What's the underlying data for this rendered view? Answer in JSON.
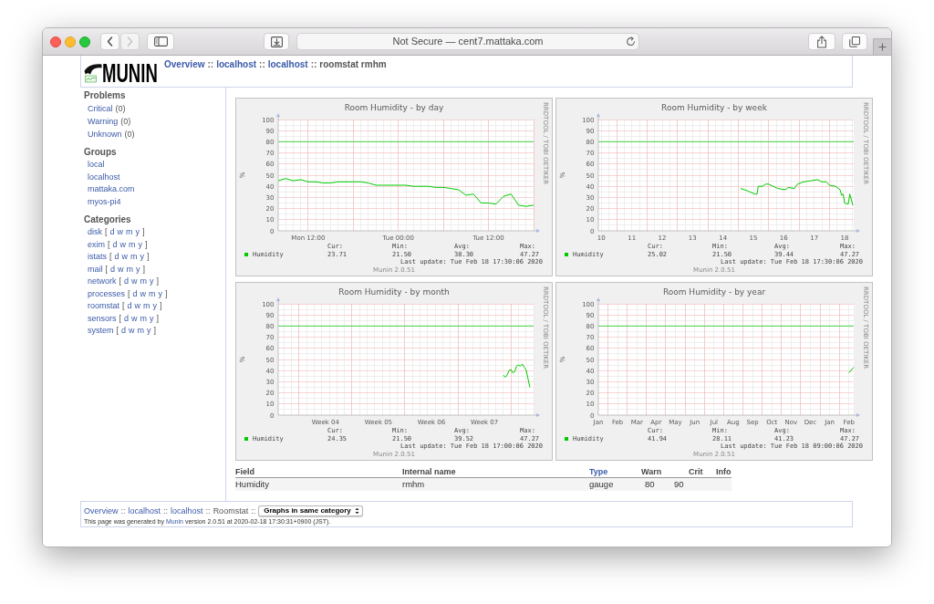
{
  "browser": {
    "address": "Not Secure — cent7.mattaka.com",
    "back": {
      "disabled": false
    },
    "forward": {
      "disabled": true
    }
  },
  "header": {
    "logo": "MUNIN",
    "breadcrumb": [
      {
        "kind": "link",
        "text": "Overview"
      },
      {
        "kind": "separator",
        "text": "::"
      },
      {
        "kind": "link",
        "text": "localhost"
      },
      {
        "kind": "separator",
        "text": "::"
      },
      {
        "kind": "link",
        "text": "localhost"
      },
      {
        "kind": "separator",
        "text": "::"
      },
      {
        "kind": "text",
        "text": "roomstat rmhm"
      }
    ]
  },
  "sidebar": {
    "problems": {
      "heading": "Problems",
      "items": [
        {
          "label": "Critical",
          "count": "(0)"
        },
        {
          "label": "Warning",
          "count": "(0)"
        },
        {
          "label": "Unknown",
          "count": "(0)"
        }
      ]
    },
    "groups": {
      "heading": "Groups",
      "items": [
        "local",
        "localhost",
        "mattaka.com",
        "myos-pi4"
      ]
    },
    "categories": {
      "heading": "Categories",
      "items": [
        {
          "name": "disk",
          "open": "[",
          "periods": [
            "d",
            "w",
            "m",
            "y"
          ],
          "close": "]"
        },
        {
          "name": "exim",
          "open": "[",
          "periods": [
            "d",
            "w",
            "m",
            "y"
          ],
          "close": "]"
        },
        {
          "name": "istats",
          "open": "[",
          "periods": [
            "d",
            "w",
            "m",
            "y"
          ],
          "close": "]"
        },
        {
          "name": "mail",
          "open": "[",
          "periods": [
            "d",
            "w",
            "m",
            "y"
          ],
          "close": "]"
        },
        {
          "name": "network",
          "open": "[",
          "periods": [
            "d",
            "w",
            "m",
            "y"
          ],
          "close": "]"
        },
        {
          "name": "processes",
          "open": "[",
          "periods": [
            "d",
            "w",
            "m",
            "y"
          ],
          "close": "]"
        },
        {
          "name": "roomstat",
          "open": "[",
          "periods": [
            "d",
            "w",
            "m",
            "y"
          ],
          "close": "]"
        },
        {
          "name": "sensors",
          "open": "[",
          "periods": [
            "d",
            "w",
            "m",
            "y"
          ],
          "close": "]"
        },
        {
          "name": "system",
          "open": "[",
          "periods": [
            "d",
            "w",
            "m",
            "y"
          ],
          "close": "]"
        }
      ]
    }
  },
  "graphs": [
    {
      "side_text": "RRDTOOL / TOBI OETIKER",
      "stat_headers": [
        "Cur:",
        "Min:",
        "Avg:",
        "Max:"
      ],
      "stat_values": [
        "23.71",
        "21.50",
        "38.30",
        "47.27"
      ],
      "last_update": "Last update: Tue Feb 18 17:30:06 2020",
      "credit": "Munin 2.0.51",
      "chart_data": {
        "type": "line",
        "title": "Room Humidity - by day",
        "ylabel": "%",
        "grid": true,
        "categories": [
          null,
          null,
          null,
          null,
          "Mon 12:00",
          null,
          null,
          null,
          null,
          null,
          null,
          null,
          null,
          null,
          null,
          null,
          "Tue 00:00",
          null,
          null,
          null,
          null,
          null,
          null,
          null,
          null,
          null,
          null,
          null,
          "Tue 12:00",
          null,
          null,
          null,
          null,
          null,
          null
        ],
        "series": [
          {
            "name": "Humidity",
            "color": "#00cc00",
            "values": [
              45,
              47,
              45,
              46,
              44,
              44,
              43,
              43,
              44,
              44,
              44,
              44,
              43,
              41,
              41,
              41,
              41,
              41,
              40,
              40,
              40,
              39,
              39,
              38,
              37,
              32,
              33,
              25,
              25,
              24,
              31,
              33,
              23,
              22,
              23
            ]
          }
        ],
        "ylim": [
          0,
          100
        ],
        "yticks": [
          0,
          10,
          20,
          30,
          40,
          50,
          60,
          70,
          80,
          90,
          100
        ],
        "ref_lines": [
          {
            "axis": "y",
            "value": 80
          }
        ]
      }
    },
    {
      "side_text": "RRDTOOL / TOBI OETIKER",
      "stat_headers": [
        "Cur:",
        "Min:",
        "Avg:",
        "Max:"
      ],
      "stat_values": [
        "25.02",
        "21.50",
        "39.44",
        "47.27"
      ],
      "last_update": "Last update: Tue Feb 18 17:30:06 2020",
      "credit": "Munin 2.0.51",
      "chart_data": {
        "type": "line",
        "title": "Room Humidity - by week",
        "ylabel": "%",
        "grid": true,
        "x": [
          14.58,
          14.8,
          15.05,
          15.12,
          15.16,
          15.3,
          15.4,
          15.5,
          15.8,
          16.05,
          16.15,
          16.35,
          16.45,
          16.65,
          16.9,
          17.1,
          17.25,
          17.4,
          17.5,
          17.7,
          17.85,
          17.9,
          17.95,
          18.0,
          18.12,
          18.17,
          18.27
        ],
        "series": [
          {
            "name": "Humidity",
            "color": "#00cc00",
            "values": [
              38,
              36,
              33,
              33,
              40,
              40,
              42,
              42,
              38,
              37,
              39,
              38,
              42,
              44,
              45,
              46,
              44,
              44,
              41,
              40,
              37,
              32,
              33,
              25,
              24,
              33,
              23
            ]
          }
        ],
        "xlim": [
          9.9,
          18.3
        ],
        "ylim": [
          0,
          100
        ],
        "xticks": [
          10,
          11,
          12,
          13,
          14,
          15,
          16,
          17,
          18
        ],
        "yticks": [
          0,
          10,
          20,
          30,
          40,
          50,
          60,
          70,
          80,
          90,
          100
        ],
        "ref_lines": [
          {
            "axis": "y",
            "value": 80
          }
        ]
      }
    },
    {
      "side_text": "RRDTOOL / TOBI OETIKER",
      "stat_headers": [
        "Cur:",
        "Min:",
        "Avg:",
        "Max:"
      ],
      "stat_values": [
        "24.35",
        "21.50",
        "39.52",
        "47.27"
      ],
      "last_update": "Last update: Tue Feb 18 17:00:06 2020",
      "credit": "Munin 2.0.51",
      "chart_data": {
        "type": "line",
        "title": "Room Humidity - by month",
        "ylabel": "%",
        "grid": true,
        "categories": [
          null,
          null,
          null,
          null,
          null,
          null,
          null,
          null,
          null,
          null,
          null,
          null,
          null,
          null,
          null,
          null,
          null,
          null,
          null,
          null,
          null,
          null,
          null,
          null,
          null,
          "Week 04",
          null,
          null,
          null,
          null,
          null,
          null,
          null,
          null,
          null,
          null,
          null,
          null,
          null,
          null,
          null,
          null,
          null,
          null,
          null,
          null,
          null,
          null,
          null,
          null,
          null,
          null,
          null,
          "Week 05",
          null,
          null,
          null,
          null,
          null,
          null,
          null,
          null,
          null,
          null,
          null,
          null,
          null,
          null,
          null,
          null,
          null,
          null,
          null,
          null,
          null,
          null,
          null,
          null,
          null,
          null,
          null,
          "Week 06",
          null,
          null,
          null,
          null,
          null,
          null,
          null,
          null,
          null,
          null,
          null,
          null,
          null,
          null,
          null,
          null,
          null,
          null,
          null,
          null,
          null,
          null,
          null,
          null,
          null,
          null,
          null,
          "Week 07",
          null,
          null,
          null,
          null,
          null,
          null,
          null,
          null,
          null,
          null,
          null,
          null,
          null,
          null,
          null,
          null,
          null,
          null,
          null,
          null,
          null,
          null,
          null,
          null,
          null,
          null
        ],
        "series": [
          {
            "name": "Humidity",
            "color": "#00cc00",
            "values": [
              null,
              null,
              null,
              null,
              null,
              null,
              null,
              null,
              null,
              null,
              null,
              null,
              null,
              null,
              null,
              null,
              null,
              null,
              null,
              null,
              null,
              null,
              null,
              null,
              null,
              null,
              null,
              null,
              null,
              null,
              null,
              null,
              null,
              null,
              null,
              null,
              null,
              null,
              null,
              null,
              null,
              null,
              null,
              null,
              null,
              null,
              null,
              null,
              null,
              null,
              null,
              null,
              null,
              null,
              null,
              null,
              null,
              null,
              null,
              null,
              null,
              null,
              null,
              null,
              null,
              null,
              null,
              null,
              null,
              null,
              null,
              null,
              null,
              null,
              null,
              null,
              null,
              null,
              null,
              null,
              null,
              null,
              null,
              null,
              null,
              null,
              null,
              null,
              null,
              null,
              null,
              null,
              null,
              null,
              null,
              null,
              null,
              null,
              null,
              null,
              null,
              null,
              null,
              null,
              null,
              null,
              null,
              null,
              null,
              null,
              null,
              null,
              null,
              null,
              null,
              null,
              null,
              null,
              null,
              36,
              34,
              36,
              40,
              41,
              38,
              39,
              44,
              45,
              44,
              46,
              43,
              41,
              33,
              25,
              null,
              null
            ]
          }
        ],
        "ylim": [
          0,
          100
        ],
        "yticks": [
          0,
          10,
          20,
          30,
          40,
          50,
          60,
          70,
          80,
          90,
          100
        ],
        "ref_lines": [
          {
            "axis": "y",
            "value": 80
          }
        ]
      }
    },
    {
      "side_text": "RRDTOOL / TOBI OETIKER",
      "stat_headers": [
        "Cur:",
        "Min:",
        "Avg:",
        "Max:"
      ],
      "stat_values": [
        "41.94",
        "28.11",
        "41.23",
        "47.27"
      ],
      "last_update": "Last update: Tue Feb 18 09:00:06 2020",
      "credit": "Munin 2.0.51",
      "chart_data": {
        "type": "line",
        "title": "Room Humidity - by year",
        "ylabel": "%",
        "grid": true,
        "categories": [
          "Jan",
          null,
          null,
          null,
          "Feb",
          null,
          null,
          null,
          "Mar",
          null,
          null,
          null,
          "Apr",
          null,
          null,
          null,
          "May",
          null,
          null,
          null,
          "Jun",
          null,
          null,
          null,
          "Jul",
          null,
          null,
          null,
          "Aug",
          null,
          null,
          null,
          "Sep",
          null,
          null,
          null,
          "Oct",
          null,
          null,
          null,
          "Nov",
          null,
          null,
          null,
          "Dec",
          null,
          null,
          null,
          "Jan",
          null,
          null,
          null,
          "Feb",
          null
        ],
        "series": [
          {
            "name": "Humidity",
            "color": "#00cc00",
            "values": [
              null,
              null,
              null,
              null,
              null,
              null,
              null,
              null,
              null,
              null,
              null,
              null,
              null,
              null,
              null,
              null,
              null,
              null,
              null,
              null,
              null,
              null,
              null,
              null,
              null,
              null,
              null,
              null,
              null,
              null,
              null,
              null,
              null,
              null,
              null,
              null,
              null,
              null,
              null,
              null,
              null,
              null,
              null,
              null,
              null,
              null,
              null,
              null,
              null,
              null,
              null,
              null,
              38,
              43
            ]
          }
        ],
        "ylim": [
          0,
          100
        ],
        "yticks": [
          0,
          10,
          20,
          30,
          40,
          50,
          60,
          70,
          80,
          90,
          100
        ],
        "ref_lines": [
          {
            "axis": "y",
            "value": 80
          }
        ]
      }
    }
  ],
  "field_table": {
    "columns": [
      {
        "label": "Field",
        "kind": "text"
      },
      {
        "label": "Internal name",
        "kind": "text"
      },
      {
        "label": "Type",
        "kind": "link"
      },
      {
        "label": "Warn",
        "kind": "text"
      },
      {
        "label": "Crit",
        "kind": "text"
      },
      {
        "label": "Info",
        "kind": "text"
      }
    ],
    "rows": [
      {
        "cells": [
          "Humidity",
          "rmhm",
          "gauge",
          "80",
          "90"
        ]
      }
    ]
  },
  "footer": {
    "breadcrumb": [
      {
        "kind": "link",
        "text": "Overview"
      },
      {
        "kind": "separator",
        "text": "::"
      },
      {
        "kind": "link",
        "text": "localhost"
      },
      {
        "kind": "separator",
        "text": "::"
      },
      {
        "kind": "link",
        "text": "localhost"
      },
      {
        "kind": "separator",
        "text": "::"
      },
      {
        "kind": "text",
        "text": "Roomstat"
      },
      {
        "kind": "separator",
        "text": "::"
      }
    ],
    "select": {
      "value": "Graphs in same category"
    },
    "note": {
      "before": "This page was generated by ",
      "link": "Munin",
      "after": " version 2.0.51 at 2020-02-18 17:30:31+0900 (JST)."
    }
  }
}
